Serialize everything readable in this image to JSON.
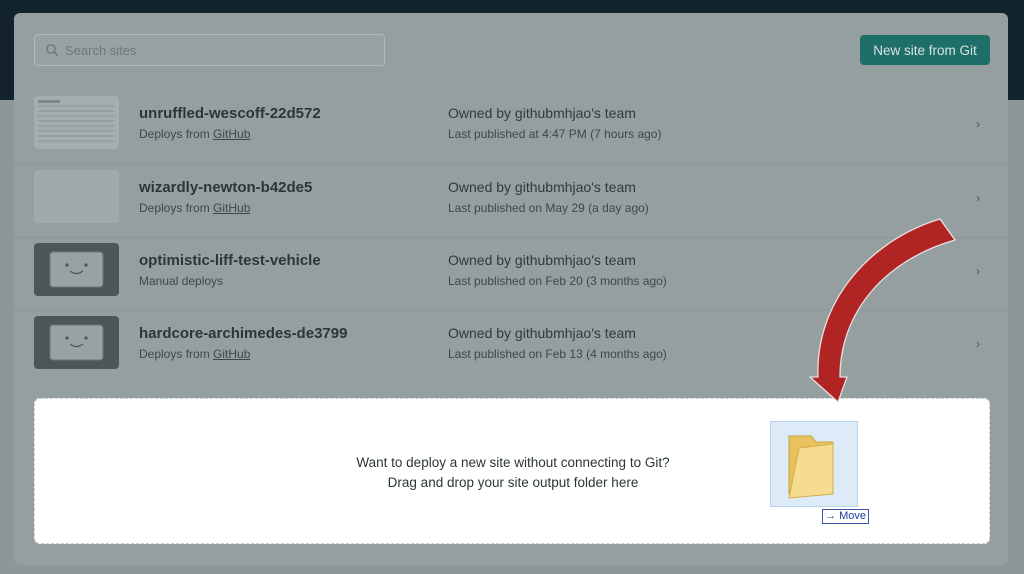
{
  "search": {
    "placeholder": "Search sites"
  },
  "header": {
    "new_site_label": "New site from Git"
  },
  "sites": [
    {
      "name": "unruffled-wescoff-22d572",
      "deploy_prefix": "Deploys from ",
      "deploy_link": "GitHub",
      "owner": "Owned by githubmhjao's team",
      "published": "Last published at 4:47 PM (7 hours ago)",
      "thumbnail": "table"
    },
    {
      "name": "wizardly-newton-b42de5",
      "deploy_prefix": "Deploys from ",
      "deploy_link": "GitHub",
      "owner": "Owned by githubmhjao's team",
      "published": "Last published on May 29 (a day ago)",
      "thumbnail": "blank"
    },
    {
      "name": "optimistic-liff-test-vehicle",
      "deploy_prefix": "Manual deploys",
      "deploy_link": "",
      "owner": "Owned by githubmhjao's team",
      "published": "Last published on Feb 20 (3 months ago)",
      "thumbnail": "face"
    },
    {
      "name": "hardcore-archimedes-de3799",
      "deploy_prefix": "Deploys from ",
      "deploy_link": "GitHub",
      "owner": "Owned by githubmhjao's team",
      "published": "Last published on Feb 13 (4 months ago)",
      "thumbnail": "face"
    }
  ],
  "dropzone": {
    "line1": "Want to deploy a new site without connecting to Git?",
    "line2": "Drag and drop your site output folder here"
  },
  "drag": {
    "tooltip_glyph": "→",
    "tooltip_label": "Move"
  },
  "colors": {
    "accent": "#1e6f67",
    "overlay": "#8d9698",
    "arrow": "#b02424"
  },
  "icons": [
    "search-icon",
    "chevron-right-icon",
    "folder-icon",
    "curved-arrow-icon"
  ]
}
